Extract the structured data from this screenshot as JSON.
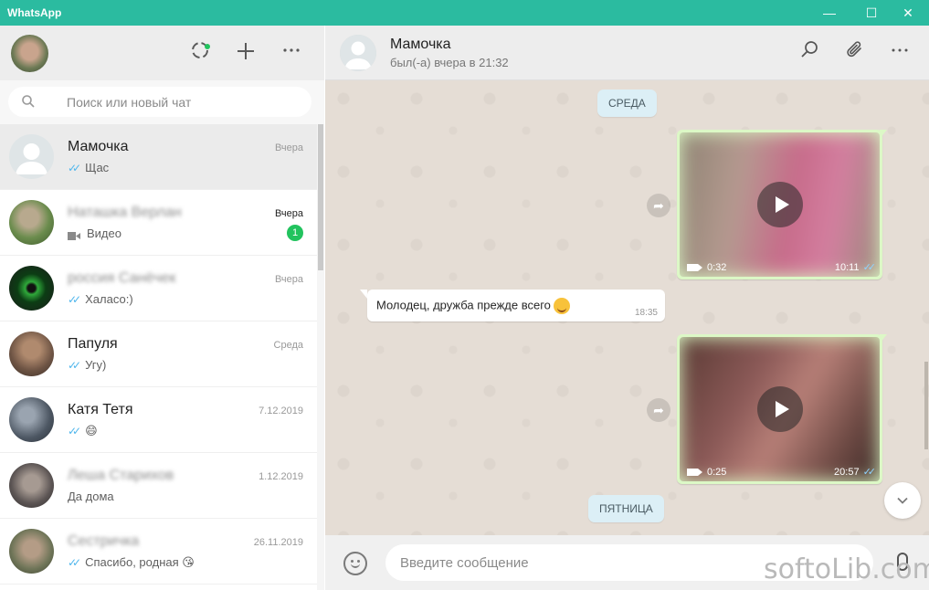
{
  "window": {
    "title": "WhatsApp",
    "minimize": "—",
    "maximize": "☐",
    "close": "✕"
  },
  "sidebar": {
    "search": {
      "placeholder": "Поиск или новый чат"
    },
    "chats": [
      {
        "name": "Мамочка",
        "time": "Вчера",
        "preview": "Щас",
        "ticks": true,
        "active": true,
        "avatar": "default"
      },
      {
        "name": "Наташка Верлан",
        "time": "Вчера",
        "preview": "Видео",
        "video": true,
        "unread": "1",
        "blurred": true,
        "avatar": "green"
      },
      {
        "name": "россия Санёчек",
        "time": "Вчера",
        "preview": "Халасо:)",
        "ticks": true,
        "blurred": true,
        "avatar": "eye"
      },
      {
        "name": "Папуля",
        "time": "Среда",
        "preview": "Угу)",
        "ticks": true,
        "avatar": "brown"
      },
      {
        "name": "Катя Тетя",
        "time": "7.12.2019",
        "preview": "😄",
        "ticks": true,
        "avatar": "sketch"
      },
      {
        "name": "Леша Старихов",
        "time": "1.12.2019",
        "preview": "Да дома",
        "blurred": true,
        "avatar": "dark"
      },
      {
        "name": "Сестричка",
        "time": "26.11.2019",
        "preview": "Спасибо, родная 😘",
        "ticks": true,
        "blurred": true,
        "avatar": "olive"
      }
    ]
  },
  "conversation": {
    "contact_name": "Мамочка",
    "contact_status": "был(-а) вчера в 21:32",
    "day_labels": {
      "wednesday": "СРЕДА",
      "friday": "ПЯТНИЦА"
    },
    "video1": {
      "duration": "0:32",
      "time": "10:11"
    },
    "text_message": {
      "text": "Молодец, дружба прежде всего",
      "time": "18:35"
    },
    "video2": {
      "duration": "0:25",
      "time": "20:57"
    },
    "composer_placeholder": "Введите сообщение"
  },
  "watermark": "softoLib.com",
  "colors": {
    "titlebar": "#2bbba0",
    "unread_badge": "#22c35e",
    "outgoing_bubble": "#dcf8c6",
    "chat_background": "#e5ddd5",
    "ticks": "#4fb6ec"
  }
}
